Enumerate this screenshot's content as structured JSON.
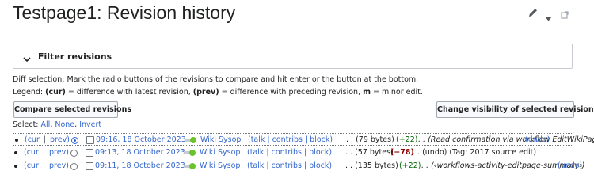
{
  "page": {
    "title": "Testpage1: Revision history"
  },
  "tools": {
    "edit_icon": "pencil-icon",
    "menu_icon": "caret-down-icon",
    "expand_icon": "external-link-icon"
  },
  "filter": {
    "title": "Filter revisions"
  },
  "help": {
    "line1": "Diff selection: Mark the radio buttons of the revisions to compare and hit enter or the button at the bottom.",
    "legend_prefix": "Legend: ",
    "legend_cur": "(cur)",
    "legend_cur_text": " = difference with latest revision, ",
    "legend_prev": "(prev)",
    "legend_prev_text": " = difference with preceding revision, ",
    "legend_m": "m",
    "legend_m_text": " = minor edit."
  },
  "buttons": {
    "compare": "Compare selected revisions",
    "visibility": "Change visibility of selected revisions"
  },
  "select": {
    "prefix": "Select: ",
    "all": "All",
    "none": "None",
    "invert": "Invert",
    "sep": ", "
  },
  "revisions": [
    {
      "cur": "(cur",
      "prev": "prev)",
      "timestamp": "09:16, 18 October 2023",
      "user": "Wiki Sysop",
      "tools": "(talk | contribs | block)",
      "size": ". . (79 bytes)",
      "diff": "(+22)",
      "summary": ". . (Read confirmation via workflow EditWikiPage)",
      "undo": "(undo)"
    },
    {
      "cur": "(cur",
      "prev": "prev)",
      "timestamp": "09:13, 18 October 2023",
      "user": "Wiki Sysop",
      "tools": "(talk | contribs | block)",
      "size": ". . (57 bytes)",
      "diff": "(−78)",
      "summary": ". . (undo) (Tag: 2017 source edit)",
      "undo": ""
    },
    {
      "cur": "(cur",
      "prev": "prev)",
      "timestamp": "09:11, 18 October 2023",
      "user": "Wiki Sysop",
      "tools": "(talk | contribs | block)",
      "size": ". . (135 bytes)",
      "diff": "(+22)",
      "summary": ". . (‹workflows-activity-editpage-summary›)",
      "undo": "(undo)"
    }
  ],
  "colors": {
    "link": "#3366cc",
    "positive": "#006400",
    "negative": "#8b0000",
    "approved": "#6ac22d"
  }
}
